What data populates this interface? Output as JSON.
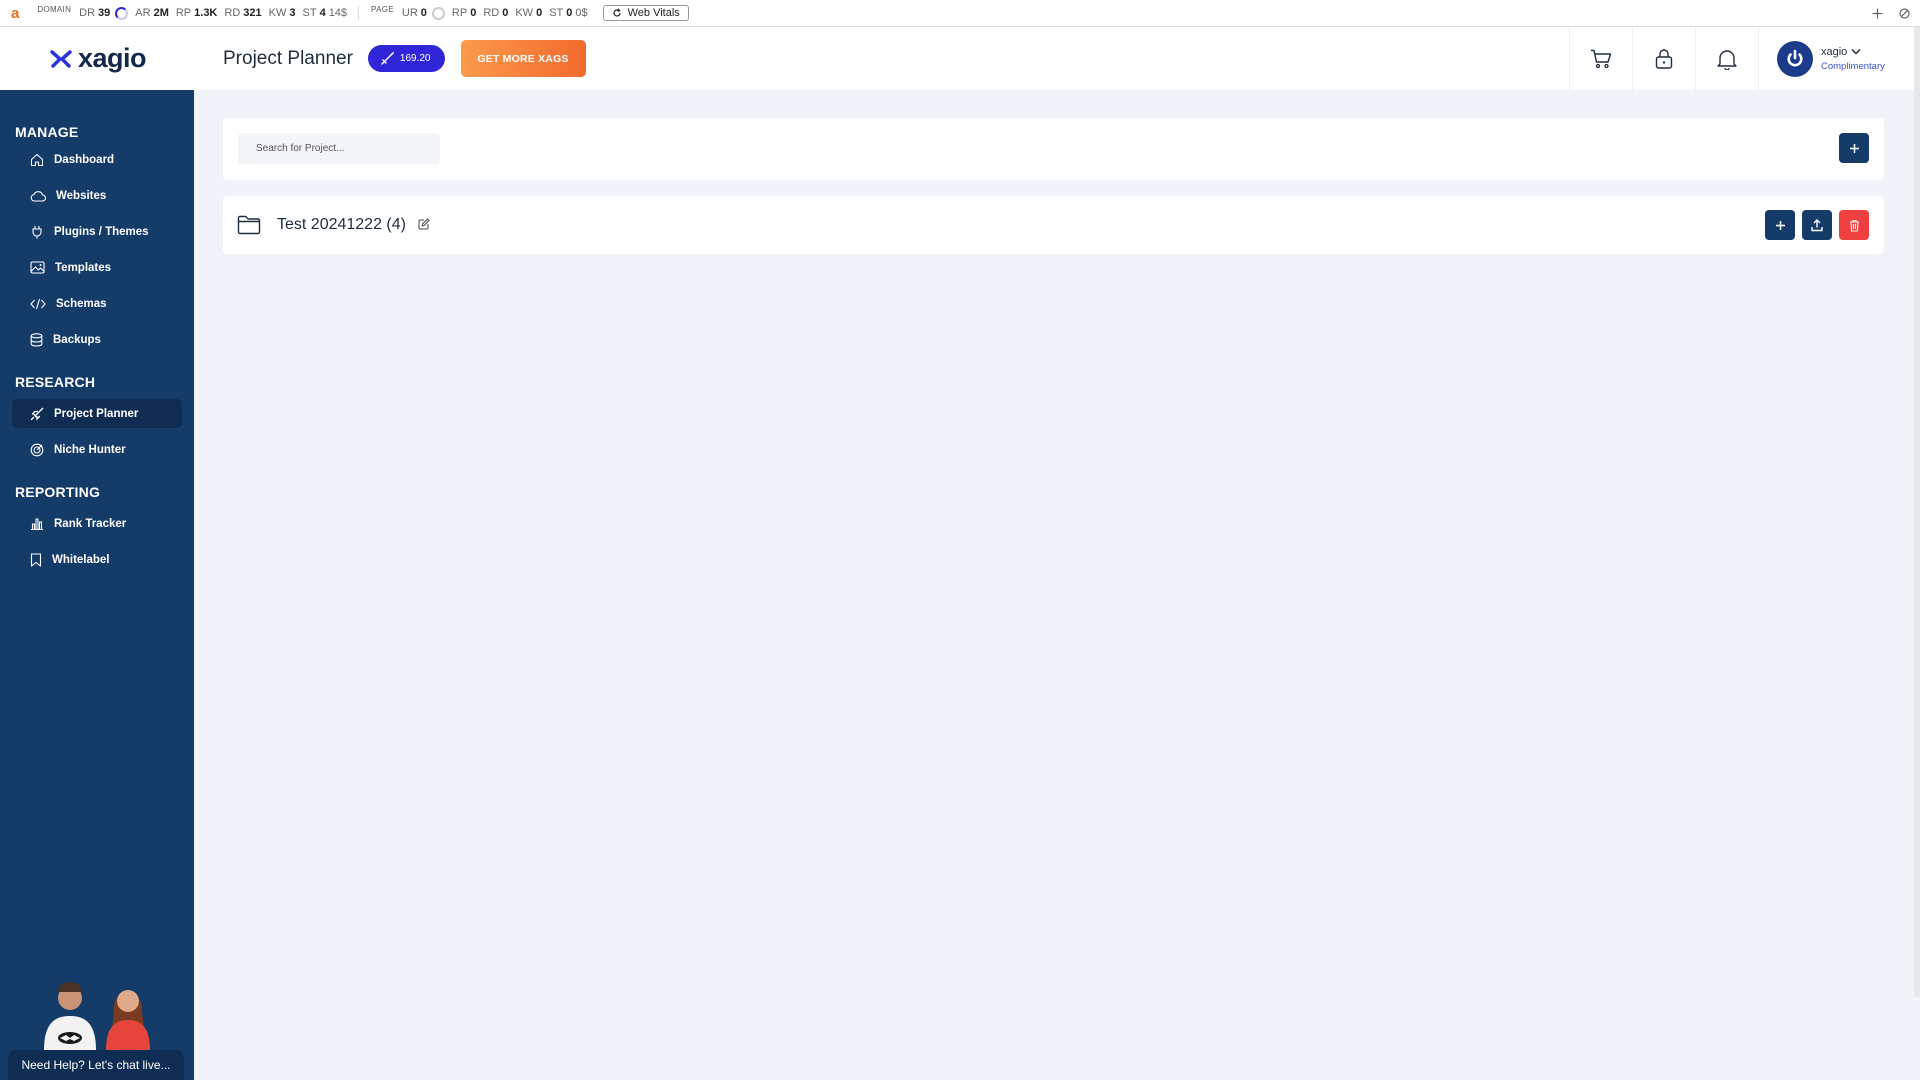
{
  "ext_bar": {
    "logo": "a",
    "domain_label": "DOMAIN",
    "page_label": "PAGE",
    "domain_metrics": [
      {
        "label": "DR",
        "value": "39",
        "has_circle": true
      },
      {
        "label": "AR",
        "value": "2M"
      },
      {
        "label": "RP",
        "value": "1.3K"
      },
      {
        "label": "RD",
        "value": "321"
      },
      {
        "label": "KW",
        "value": "3"
      },
      {
        "label": "ST",
        "value": "4",
        "extra": "14$"
      }
    ],
    "page_metrics": [
      {
        "label": "UR",
        "value": "0",
        "has_circle": true
      },
      {
        "label": "RP",
        "value": "0"
      },
      {
        "label": "RD",
        "value": "0"
      },
      {
        "label": "KW",
        "value": "0"
      },
      {
        "label": "ST",
        "value": "0",
        "extra": "0$"
      }
    ],
    "web_vitals_label": "Web Vitals"
  },
  "header": {
    "brand": "xagio",
    "page_title": "Project Planner",
    "xags_balance": "169.20",
    "get_more_label": "GET MORE XAGS",
    "user_name": "xagio",
    "user_plan": "Complimentary"
  },
  "sidebar": {
    "sections": [
      {
        "title": "MANAGE",
        "items": [
          {
            "label": "Dashboard",
            "icon": "home-icon"
          },
          {
            "label": "Websites",
            "icon": "cloud-icon"
          },
          {
            "label": "Plugins / Themes",
            "icon": "plug-icon"
          },
          {
            "label": "Templates",
            "icon": "image-icon"
          },
          {
            "label": "Schemas",
            "icon": "code-icon"
          },
          {
            "label": "Backups",
            "icon": "database-icon"
          }
        ]
      },
      {
        "title": "RESEARCH",
        "items": [
          {
            "label": "Project Planner",
            "icon": "rocket-icon",
            "active": true
          },
          {
            "label": "Niche Hunter",
            "icon": "target-icon"
          }
        ]
      },
      {
        "title": "REPORTING",
        "items": [
          {
            "label": "Rank Tracker",
            "icon": "bar-chart-icon"
          },
          {
            "label": "Whitelabel",
            "icon": "bookmark-icon"
          }
        ]
      }
    ],
    "chat_label": "Need Help? Let's chat live..."
  },
  "main": {
    "search_placeholder": "Search for Project...",
    "projects": [
      {
        "name": "Test 20241222 (4)"
      }
    ]
  },
  "colors": {
    "sidebar_bg": "#153b69",
    "accent_navy": "#153b69",
    "xags_pill": "#3026d8",
    "get_more_orange": "#f26a2e",
    "delete_red": "#ef3f3f"
  }
}
